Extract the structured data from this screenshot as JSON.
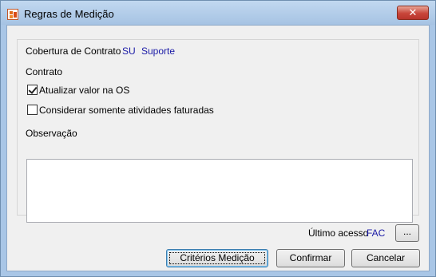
{
  "window": {
    "title": "Regras de Medição",
    "app_icon": "app-logo-icon",
    "close_label": "✕"
  },
  "cobertura": {
    "label": "Cobertura de Contrato",
    "code": "SU",
    "name": "Suporte"
  },
  "contrato": {
    "label": "Contrato"
  },
  "options": {
    "atualizar": {
      "label": "Atualizar valor na OS",
      "checked": true
    },
    "considerar": {
      "label": "Considerar somente atividades faturadas",
      "checked": false
    }
  },
  "observacao": {
    "label": "Observação",
    "value": ""
  },
  "ultimo_acesso": {
    "label": "Último acesso",
    "value": "FAC",
    "more_label": "..."
  },
  "buttons": {
    "criterios": "Critérios Medição",
    "confirmar": "Confirmar",
    "cancelar": "Cancelar"
  },
  "colors": {
    "title_bar": "#a9c6e6",
    "link_text": "#1a1aa6",
    "close_button": "#c8453a"
  }
}
